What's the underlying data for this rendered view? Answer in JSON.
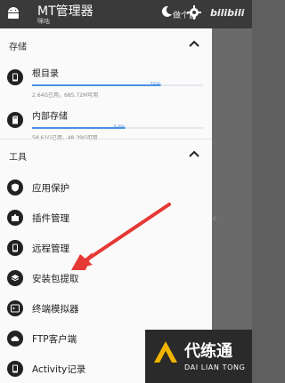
{
  "appbar": {
    "title": "MT管理器",
    "subtitle": "咪咕",
    "watermark_text": "做个菌",
    "bili_text": "bilibili"
  },
  "sections": {
    "storage_label": "存储",
    "tools_label": "工具"
  },
  "storage": [
    {
      "name": "根目录",
      "percent": 75,
      "percent_label": "75%",
      "detail": "2.64G已用，685.72M可用"
    },
    {
      "name": "内部存储",
      "percent": 54,
      "percent_label": "54%",
      "detail": "58.61G已用，48.39G可用"
    }
  ],
  "tools": [
    {
      "name": "应用保护",
      "icon": "shield-icon"
    },
    {
      "name": "插件管理",
      "icon": "puzzle-icon"
    },
    {
      "name": "远程管理",
      "icon": "phone-icon"
    },
    {
      "name": "安装包提取",
      "icon": "layers-icon"
    },
    {
      "name": "终端模拟器",
      "icon": "terminal-icon"
    },
    {
      "name": "FTP客户端",
      "icon": "cloud-icon"
    },
    {
      "name": "Activity记录",
      "icon": "phone-icon"
    }
  ],
  "watermark_badge": {
    "title": "代练通",
    "subtitle": "DAI LIAN TONG"
  },
  "colors": {
    "accent": "#4a90e2",
    "arrow": "#e53935",
    "appbar": "#3a3a3a",
    "drawer": "#fafafa"
  }
}
